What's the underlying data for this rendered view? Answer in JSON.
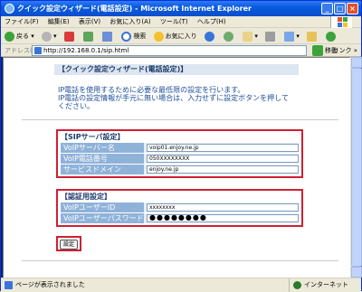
{
  "window": {
    "title": "クイック設定ウィザード(電話設定) - Microsoft Internet Explorer",
    "controls": {
      "minimize": "_",
      "maximize": "□",
      "close": "×"
    }
  },
  "menubar": {
    "items": [
      "ファイル(F)",
      "編集(E)",
      "表示(V)",
      "お気に入り(A)",
      "ツール(T)",
      "ヘルプ(H)"
    ]
  },
  "toolbar": {
    "back": "戻る",
    "search": "検索",
    "favorites": "お気に入り"
  },
  "addressbar": {
    "label": "アドレス(D)",
    "url": "http://192.168.0.1/sip.html",
    "go": "移動",
    "links": "リンク »"
  },
  "page": {
    "title": "【クイック設定ウィザード(電話設定)】",
    "intro_line1": "IP電話を使用するために必要な最低限の設定を行います。",
    "intro_line2": "IP電話の設定情報が手元に無い場合は、入力せずに設定ボタンを押して",
    "intro_line3": "ください。",
    "sip_section": {
      "header": "【SIPサーバ設定】",
      "rows": [
        {
          "label": "VoIPサーバー名",
          "value": "voip01.enjoy.ne.jp"
        },
        {
          "label": "VoIP電話番号",
          "value": "050XXXXXXXX"
        },
        {
          "label": "サービスドメイン",
          "value": "enjoy.ne.jp"
        }
      ]
    },
    "auth_section": {
      "header": "【認証用設定】",
      "rows": [
        {
          "label": "VoIPユーザーID",
          "value": "xxxxxxxx"
        },
        {
          "label": "VoIPユーザーパスワード",
          "value": "●●●●●●●●"
        }
      ]
    },
    "submit_label": "設定"
  },
  "statusbar": {
    "text": "ページが表示されました",
    "zone": "インターネット"
  }
}
